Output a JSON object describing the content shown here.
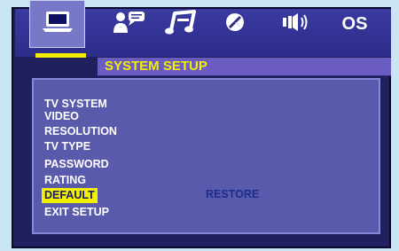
{
  "title": "SYSTEM SETUP",
  "tabs": [
    {
      "icon": "tv-monitor-icon"
    },
    {
      "icon": "language-icon"
    },
    {
      "icon": "audio-icon"
    },
    {
      "icon": "video-icon"
    },
    {
      "icon": "speaker-icon"
    },
    {
      "label": "OS"
    }
  ],
  "menu": [
    {
      "label": "TV SYSTEM"
    },
    {
      "label": "VIDEO"
    },
    {
      "label": "RESOLUTION"
    },
    {
      "label": "TV TYPE"
    },
    {
      "label": "PASSWORD"
    },
    {
      "label": "RATING"
    },
    {
      "label": "DEFAULT",
      "selected": true
    },
    {
      "label": "EXIT SETUP"
    }
  ],
  "option_value": "RESTORE",
  "colors": {
    "highlight": "#f2f000",
    "panel": "#5a5aad",
    "title_bar": "#6a5cc0",
    "frame": "#20205f",
    "background": "#c9e4f2"
  }
}
